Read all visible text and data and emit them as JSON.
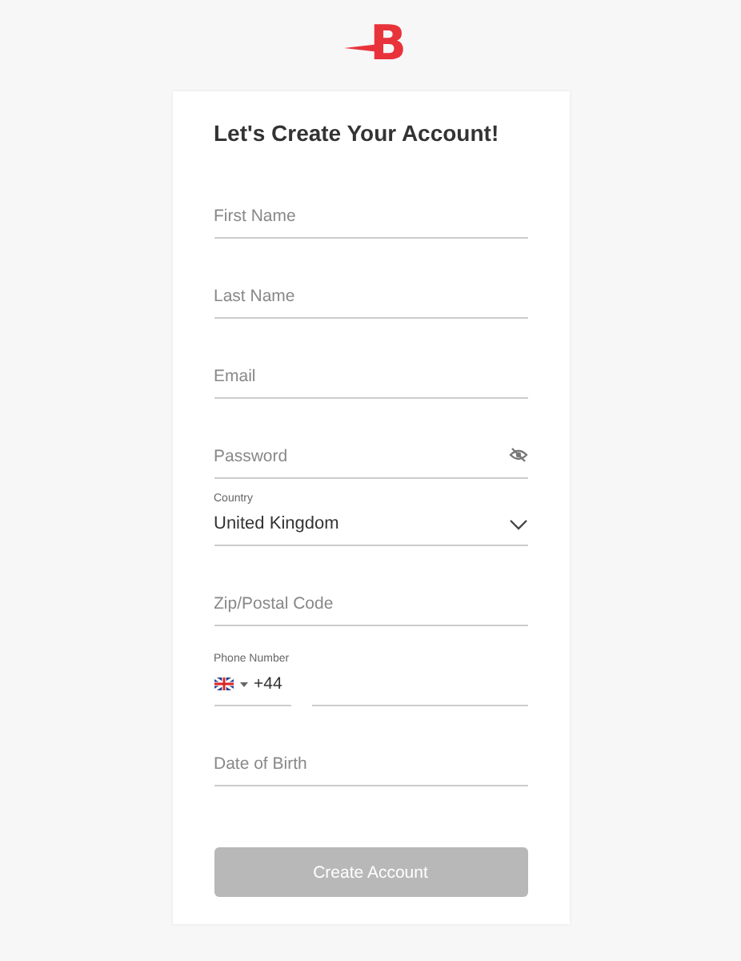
{
  "logo": {
    "text": "B"
  },
  "form": {
    "title": "Let's Create Your Account!",
    "fields": [
      {
        "kind": "text",
        "placeholder": "First Name"
      },
      {
        "kind": "text",
        "placeholder": "Last Name"
      },
      {
        "kind": "text",
        "placeholder": "Email"
      },
      {
        "kind": "password",
        "placeholder": "Password"
      },
      {
        "kind": "select",
        "label": "Country",
        "value": "United Kingdom"
      },
      {
        "kind": "text",
        "placeholder": "Zip/Postal Code"
      },
      {
        "kind": "phone",
        "label": "Phone Number",
        "code": "+44"
      },
      {
        "kind": "text",
        "placeholder": "Date of Birth"
      }
    ],
    "submit": {
      "label": "Create Account",
      "disabled": true
    }
  }
}
